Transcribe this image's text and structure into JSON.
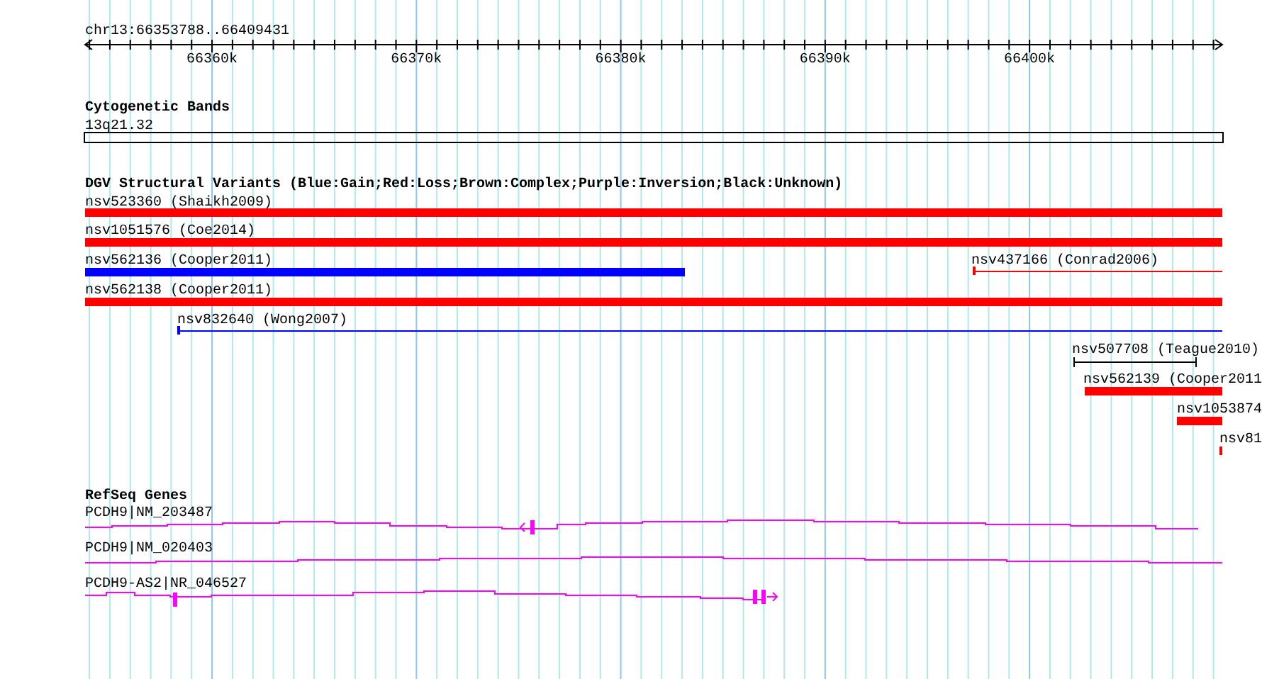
{
  "ruler": {
    "region": "chr13:66353788..66409431",
    "ticks": [
      "66360k",
      "66370k",
      "66380k",
      "66390k",
      "66400k"
    ]
  },
  "cytogenetic_bands": {
    "title": "Cytogenetic Bands",
    "band": "13q21.32"
  },
  "structural_variants": {
    "title": "DGV Structural Variants (Blue:Gain;Red:Loss;Brown:Complex;Purple:Inversion;Black:Unknown)",
    "variants": [
      {
        "label": "nsv523360 (Shaikh2009)",
        "kind": "bar",
        "color": "#ff0000"
      },
      {
        "label": "nsv1051576 (Coe2014)",
        "kind": "bar",
        "color": "#ff0000"
      },
      {
        "label": "nsv562136 (Cooper2011)",
        "kind": "bar",
        "color": "#0000ff"
      },
      {
        "label": "nsv437166 (Conrad2006)",
        "kind": "line",
        "color": "#ff0000"
      },
      {
        "label": "nsv562138 (Cooper2011)",
        "kind": "bar",
        "color": "#ff0000"
      },
      {
        "label": "nsv832640 (Wong2007)",
        "kind": "line",
        "color": "#0000ff"
      },
      {
        "label": "nsv507708 (Teague2010)",
        "kind": "interval",
        "color": "#000000"
      },
      {
        "label": "nsv562139 (Cooper2011",
        "kind": "bar",
        "color": "#ff0000"
      },
      {
        "label": "nsv1053874",
        "kind": "bar",
        "color": "#ff0000"
      },
      {
        "label": "nsv81",
        "kind": "bar",
        "color": "#ff0000"
      }
    ]
  },
  "refseq_genes": {
    "title": "RefSeq Genes",
    "genes": [
      {
        "label": "PCDH9|NM_203487"
      },
      {
        "label": "PCDH9|NM_020403"
      },
      {
        "label": "PCDH9-AS2|NR_046527"
      }
    ]
  }
}
